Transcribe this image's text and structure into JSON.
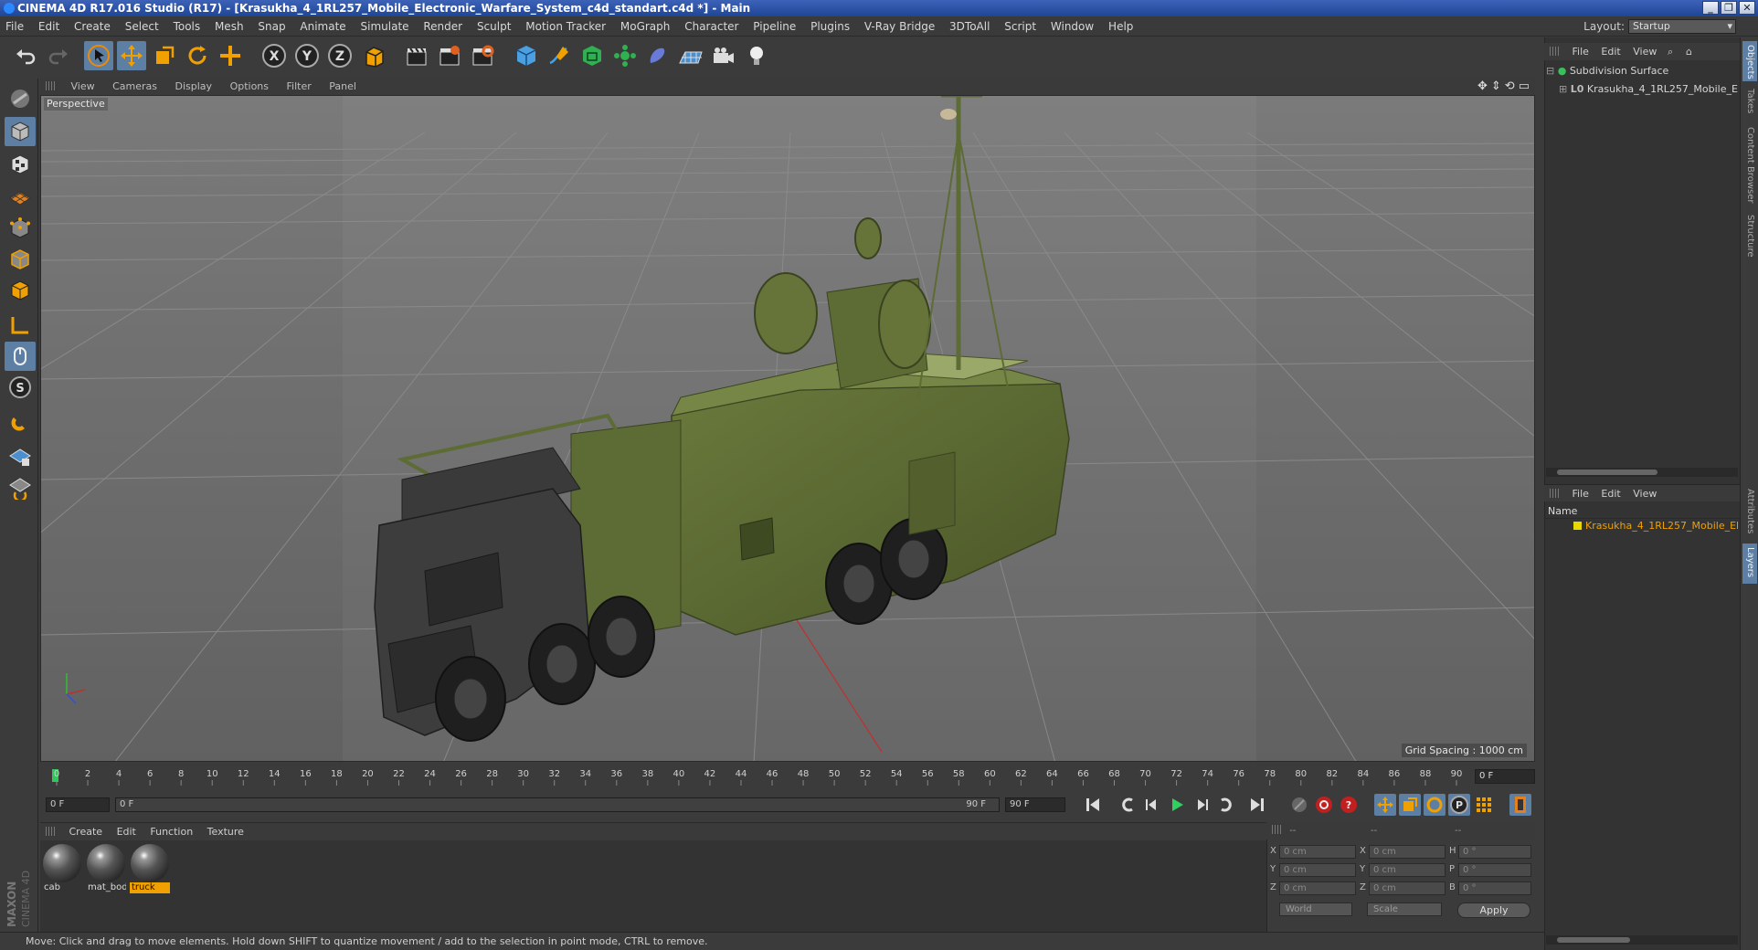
{
  "window": {
    "title": "CINEMA 4D R17.016 Studio (R17) - [Krasukha_4_1RL257_Mobile_Electronic_Warfare_System_c4d_standart.c4d *] - Main",
    "controls": [
      "_",
      "❐",
      "✕"
    ]
  },
  "menu": [
    "File",
    "Edit",
    "Create",
    "Select",
    "Tools",
    "Mesh",
    "Snap",
    "Animate",
    "Simulate",
    "Render",
    "Sculpt",
    "Motion Tracker",
    "MoGraph",
    "Character",
    "Pipeline",
    "Plugins",
    "V-Ray Bridge",
    "3DToAll",
    "Script",
    "Window",
    "Help"
  ],
  "layout": {
    "label": "Layout:",
    "value": "Startup"
  },
  "viewport": {
    "menu": [
      "View",
      "Cameras",
      "Display",
      "Options",
      "Filter",
      "Panel"
    ],
    "camera_label": "Perspective",
    "grid_spacing": "Grid Spacing : 1000 cm",
    "nav_icons": [
      "✥",
      "⇕",
      "⟲",
      "▭"
    ]
  },
  "timeline": {
    "ticks": [
      "0",
      "2",
      "4",
      "6",
      "8",
      "10",
      "12",
      "14",
      "16",
      "18",
      "20",
      "22",
      "24",
      "26",
      "28",
      "30",
      "32",
      "34",
      "36",
      "38",
      "40",
      "42",
      "44",
      "46",
      "48",
      "50",
      "52",
      "54",
      "56",
      "58",
      "60",
      "62",
      "64",
      "66",
      "68",
      "70",
      "72",
      "74",
      "76",
      "78",
      "80",
      "82",
      "84",
      "86",
      "88",
      "90"
    ],
    "current_frame": "0 F",
    "start_frame": "0 F",
    "range_start": "0 F",
    "range_end": "90 F",
    "end_frame": "90 F"
  },
  "materials": {
    "menu": [
      "Create",
      "Edit",
      "Function",
      "Texture"
    ],
    "items": [
      {
        "name": "cab",
        "selected": false
      },
      {
        "name": "mat_bod",
        "selected": false
      },
      {
        "name": "truck",
        "selected": true
      }
    ]
  },
  "coordinates": {
    "headers": [
      "--",
      "--",
      "--"
    ],
    "rows": [
      {
        "axis": "X",
        "pos": "0 cm",
        "axis2": "X",
        "size": "0 cm",
        "axis3": "H",
        "rot": "0 °"
      },
      {
        "axis": "Y",
        "pos": "0 cm",
        "axis2": "Y",
        "size": "0 cm",
        "axis3": "P",
        "rot": "0 °"
      },
      {
        "axis": "Z",
        "pos": "0 cm",
        "axis2": "Z",
        "size": "0 cm",
        "axis3": "B",
        "rot": "0 °"
      }
    ],
    "mode": "World",
    "size_mode": "Scale",
    "apply": "Apply"
  },
  "objects": {
    "menu": [
      "File",
      "Edit",
      "View"
    ],
    "tree": [
      {
        "name": "Subdivision Surface",
        "level": 0
      },
      {
        "name": "Krasukha_4_1RL257_Mobile_Electr",
        "level": 1
      }
    ]
  },
  "layers": {
    "menu": [
      "File",
      "Edit",
      "View"
    ],
    "column_name": "Name",
    "items": [
      "Krasukha_4_1RL257_Mobile_Electro"
    ]
  },
  "side_tabs": [
    "Objects",
    "Takes",
    "Content Browser",
    "Structure",
    "Attributes",
    "Layers"
  ],
  "status": "Move: Click and drag to move elements. Hold down SHIFT to quantize movement / add to the selection in point mode, CTRL to remove.",
  "brand": {
    "line1": "MAXON",
    "line2": "CINEMA 4D"
  },
  "colors": {
    "accent": "#5e7fa4",
    "selection": "#f0a000",
    "viewport_bg": "#6e6e6e",
    "truck_olive": "#5d6b34"
  }
}
